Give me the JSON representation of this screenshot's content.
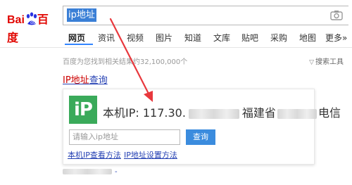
{
  "header": {
    "logo_bai": "Bai",
    "logo_du": "百度",
    "search_query": "ip地址"
  },
  "nav": {
    "items": [
      "网页",
      "资讯",
      "视频",
      "图片",
      "知道",
      "文库",
      "贴吧",
      "采购",
      "地图",
      "更多»"
    ],
    "active": "网页",
    "accent_color": "#3385ff"
  },
  "results": {
    "count_text": "百度为您找到相关结果约32,100,000个",
    "search_tools": "搜索工具"
  },
  "result_card": {
    "title_prefix": "IP地址",
    "title_suffix": "查询",
    "logo_text": "iP",
    "ip_label": "本机IP: 117.30.",
    "ip_location_a": "福建省",
    "ip_location_b": "电信",
    "input_placeholder": "请输入ip地址",
    "query_button": "查询",
    "link_1": "本机IP查看方法",
    "link_2": "IP地址设置方法"
  },
  "bottom": {
    "tail": "-"
  },
  "colors": {
    "brand_red": "#e10601",
    "link_blue": "#2440b3",
    "logo_green": "#3aaa5a",
    "button_blue": "#3b8cde",
    "annotation_red": "#e8383d"
  }
}
